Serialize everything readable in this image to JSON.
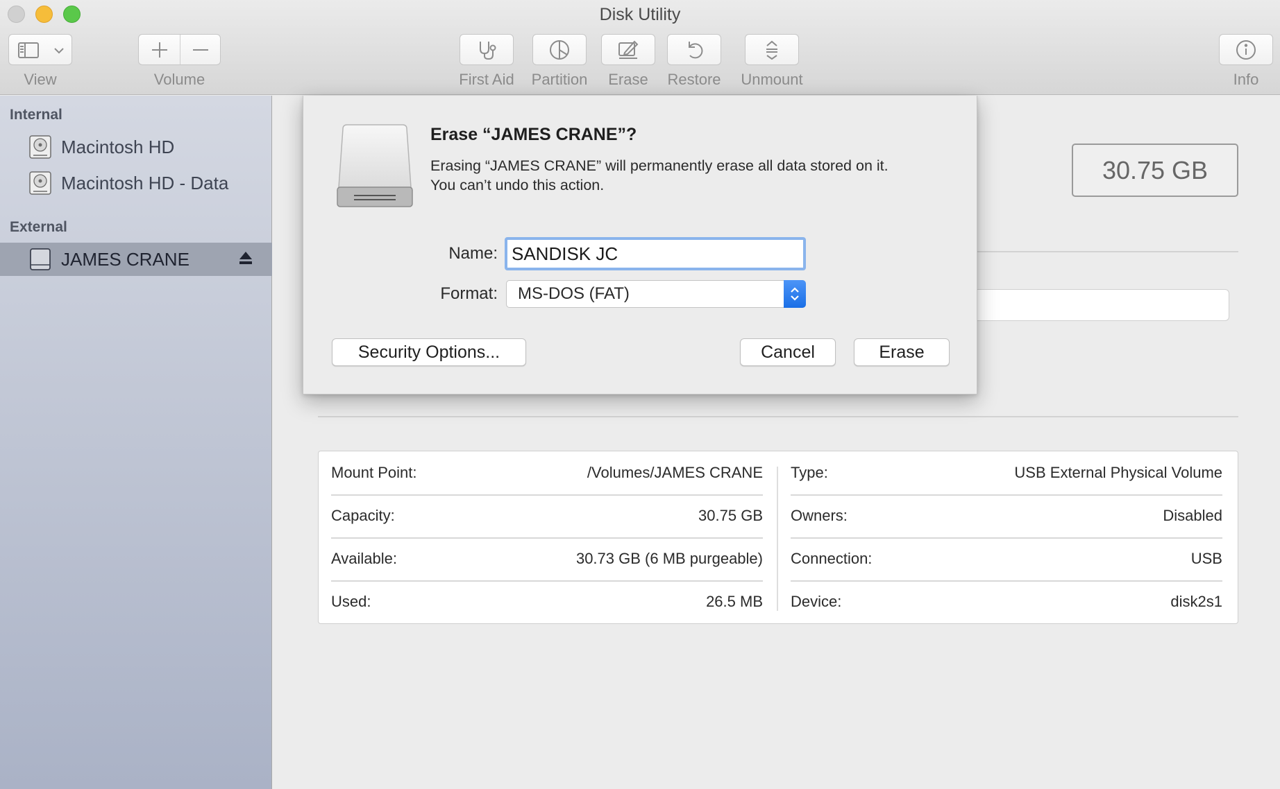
{
  "window": {
    "title": "Disk Utility"
  },
  "toolbar": {
    "view_label": "View",
    "volume_label": "Volume",
    "first_aid_label": "First Aid",
    "partition_label": "Partition",
    "erase_label": "Erase",
    "restore_label": "Restore",
    "unmount_label": "Unmount",
    "info_label": "Info"
  },
  "sidebar": {
    "internal_header": "Internal",
    "external_header": "External",
    "internal_items": [
      {
        "label": "Macintosh HD"
      },
      {
        "label": "Macintosh HD - Data"
      }
    ],
    "external_items": [
      {
        "label": "JAMES CRANE",
        "selected": true
      }
    ]
  },
  "main": {
    "capacity_display": "30.75 GB",
    "info": {
      "left": [
        {
          "key": "Mount Point:",
          "value": "/Volumes/JAMES CRANE"
        },
        {
          "key": "Capacity:",
          "value": "30.75 GB"
        },
        {
          "key": "Available:",
          "value": "30.73 GB (6 MB purgeable)"
        },
        {
          "key": "Used:",
          "value": "26.5 MB"
        }
      ],
      "right": [
        {
          "key": "Type:",
          "value": "USB External Physical Volume"
        },
        {
          "key": "Owners:",
          "value": "Disabled"
        },
        {
          "key": "Connection:",
          "value": "USB"
        },
        {
          "key": "Device:",
          "value": "disk2s1"
        }
      ]
    }
  },
  "dialog": {
    "title": "Erase “JAMES CRANE”?",
    "message_line1": "Erasing “JAMES CRANE” will permanently erase all data stored on it.",
    "message_line2": "You can’t undo this action.",
    "name_label": "Name:",
    "name_value": "SANDISK JC",
    "format_label": "Format:",
    "format_value": "MS-DOS (FAT)",
    "security_button": "Security Options...",
    "cancel_button": "Cancel",
    "erase_button": "Erase"
  },
  "colors": {
    "accent": "#1a6fe6",
    "focus_ring": "#8ab4ec",
    "sidebar_selected": "#9ea4b1"
  }
}
